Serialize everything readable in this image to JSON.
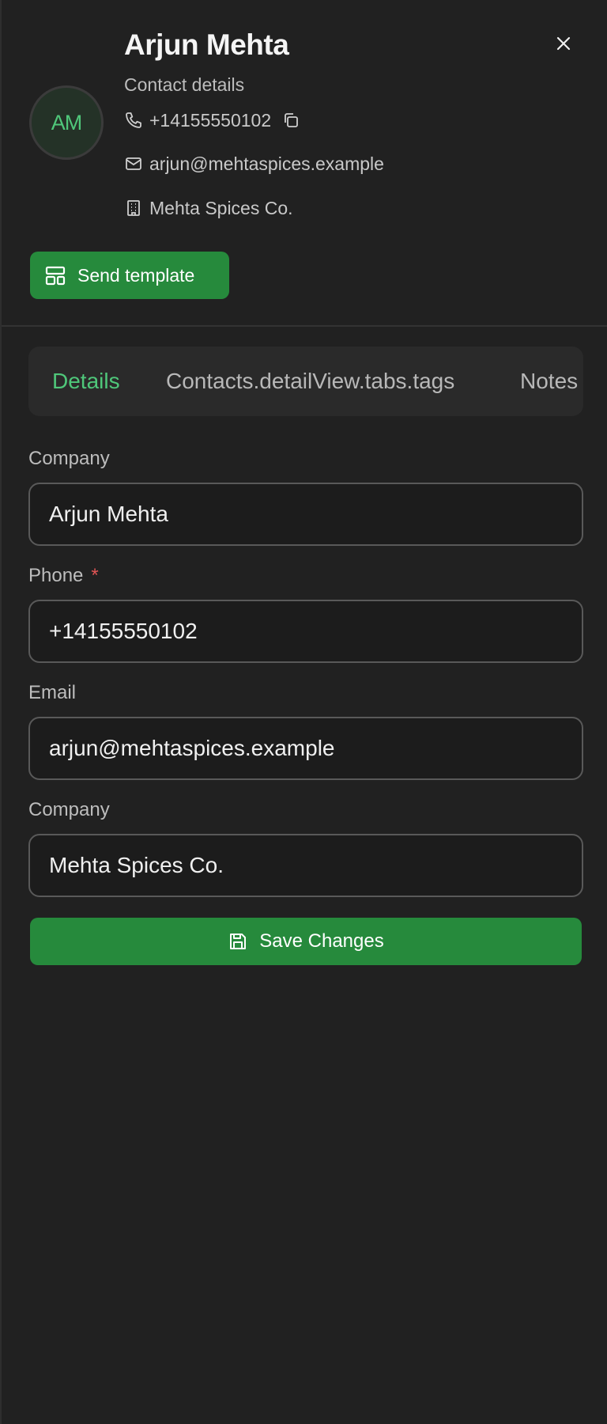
{
  "contact": {
    "initials": "AM",
    "name": "Arjun Mehta",
    "subtitle": "Contact details",
    "phone": "+14155550102",
    "email": "arjun@mehtaspices.example",
    "company": "Mehta Spices Co."
  },
  "actions": {
    "send_template_label": "Send template",
    "save_label": "Save Changes"
  },
  "tabs": [
    {
      "label": "Details",
      "active": true
    },
    {
      "label": "Contacts.detailView.tabs.tags",
      "active": false
    },
    {
      "label": "Notes",
      "active": false
    }
  ],
  "form": {
    "name_field": {
      "label": "Company",
      "value": "Arjun Mehta"
    },
    "phone_field": {
      "label": "Phone",
      "required_mark": "*",
      "value": "+14155550102"
    },
    "email_field": {
      "label": "Email",
      "value": "arjun@mehtaspices.example"
    },
    "company_field": {
      "label": "Company",
      "value": "Mehta Spices Co."
    }
  },
  "colors": {
    "accent_green": "#268a3c",
    "active_tab": "#4fc77a",
    "background": "#212121"
  },
  "icons": {
    "close": "close-icon",
    "phone": "phone-icon",
    "copy": "copy-icon",
    "email": "mail-icon",
    "company": "building-icon",
    "template": "layout-template-icon",
    "save": "save-icon"
  }
}
